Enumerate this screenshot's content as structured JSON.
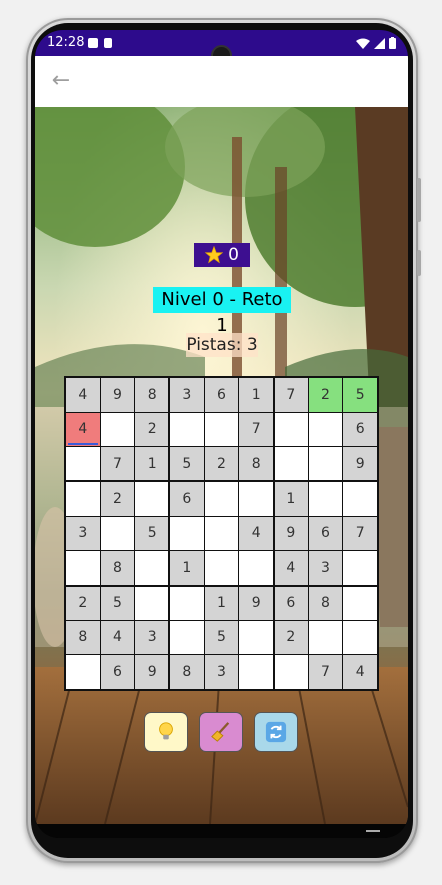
{
  "status_bar": {
    "time": "12:28"
  },
  "header": {
    "back_icon": "arrow-back-icon"
  },
  "game": {
    "stars": "0",
    "level_label": "Nivel 0 - Reto 1",
    "clues_label": "Pistas: 3",
    "grid": [
      [
        "4",
        "9",
        "8",
        "3",
        "6",
        "1",
        "7",
        "2",
        "5"
      ],
      [
        "4",
        "",
        "2",
        "",
        "",
        "7",
        "",
        "",
        "6"
      ],
      [
        "",
        "7",
        "1",
        "5",
        "2",
        "8",
        "",
        "",
        "9"
      ],
      [
        "",
        "2",
        "",
        "6",
        "",
        "",
        "1",
        "",
        ""
      ],
      [
        "3",
        "",
        "5",
        "",
        "",
        "4",
        "9",
        "6",
        "7"
      ],
      [
        "",
        "8",
        "",
        "1",
        "",
        "",
        "4",
        "3",
        ""
      ],
      [
        "2",
        "5",
        "",
        "",
        "1",
        "9",
        "6",
        "8",
        ""
      ],
      [
        "8",
        "4",
        "3",
        "",
        "5",
        "",
        "2",
        "",
        ""
      ],
      [
        "",
        "6",
        "9",
        "8",
        "3",
        "",
        "",
        "7",
        "4"
      ]
    ],
    "actions": [
      {
        "name": "hint-button",
        "icon": "lightbulb-icon",
        "color": "#fff8c8"
      },
      {
        "name": "erase-button",
        "icon": "broom-icon",
        "color": "#d98bd0"
      },
      {
        "name": "restart-button",
        "icon": "refresh-icon",
        "color": "#a9d8ea"
      }
    ]
  },
  "colors": {
    "status_bar": "#2d0b8c",
    "level_bg": "#19f2f2",
    "star_badge": "#3d0f90",
    "correct": "#86e07f",
    "error": "#f07c7c"
  }
}
